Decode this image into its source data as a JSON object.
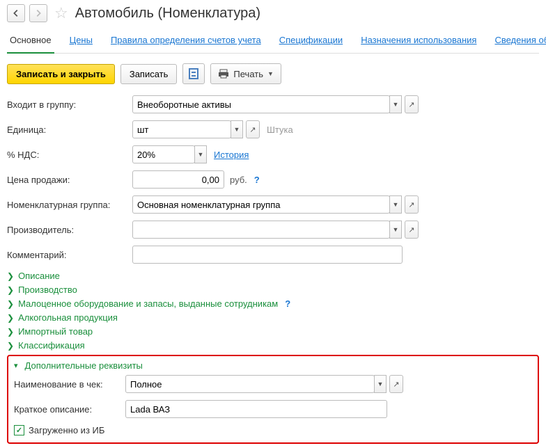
{
  "header": {
    "title": "Автомобиль (Номенклатура)"
  },
  "tabs": [
    {
      "label": "Основное",
      "active": true
    },
    {
      "label": "Цены"
    },
    {
      "label": "Правила определения счетов учета"
    },
    {
      "label": "Спецификации"
    },
    {
      "label": "Назначения использования"
    },
    {
      "label": "Сведения об алко"
    }
  ],
  "toolbar": {
    "save_close": "Записать и закрыть",
    "save": "Записать",
    "print": "Печать"
  },
  "form": {
    "group_label": "Входит в группу:",
    "group_value": "Внеоборотные активы",
    "unit_label": "Единица:",
    "unit_value": "шт",
    "unit_after": "Штука",
    "vat_label": "% НДС:",
    "vat_value": "20%",
    "vat_history": "История",
    "price_label": "Цена продажи:",
    "price_value": "0,00",
    "price_after": "руб.",
    "nomgroup_label": "Номенклатурная группа:",
    "nomgroup_value": "Основная номенклатурная группа",
    "manufacturer_label": "Производитель:",
    "manufacturer_value": "",
    "comment_label": "Комментарий:",
    "comment_value": ""
  },
  "expanders": [
    {
      "label": "Описание"
    },
    {
      "label": "Производство"
    },
    {
      "label": "Малоценное оборудование и запасы, выданные сотрудникам",
      "help": true
    },
    {
      "label": "Алкогольная продукция"
    },
    {
      "label": "Импортный товар"
    },
    {
      "label": "Классификация"
    }
  ],
  "extra": {
    "title": "Дополнительные реквизиты",
    "chk_name_label": "Наименование в чек:",
    "chk_name_value": "Полное",
    "short_desc_label": "Краткое описание:",
    "short_desc_value": "Lada ВАЗ",
    "loaded_label": "Загруженно из ИБ",
    "loaded_checked": true
  }
}
